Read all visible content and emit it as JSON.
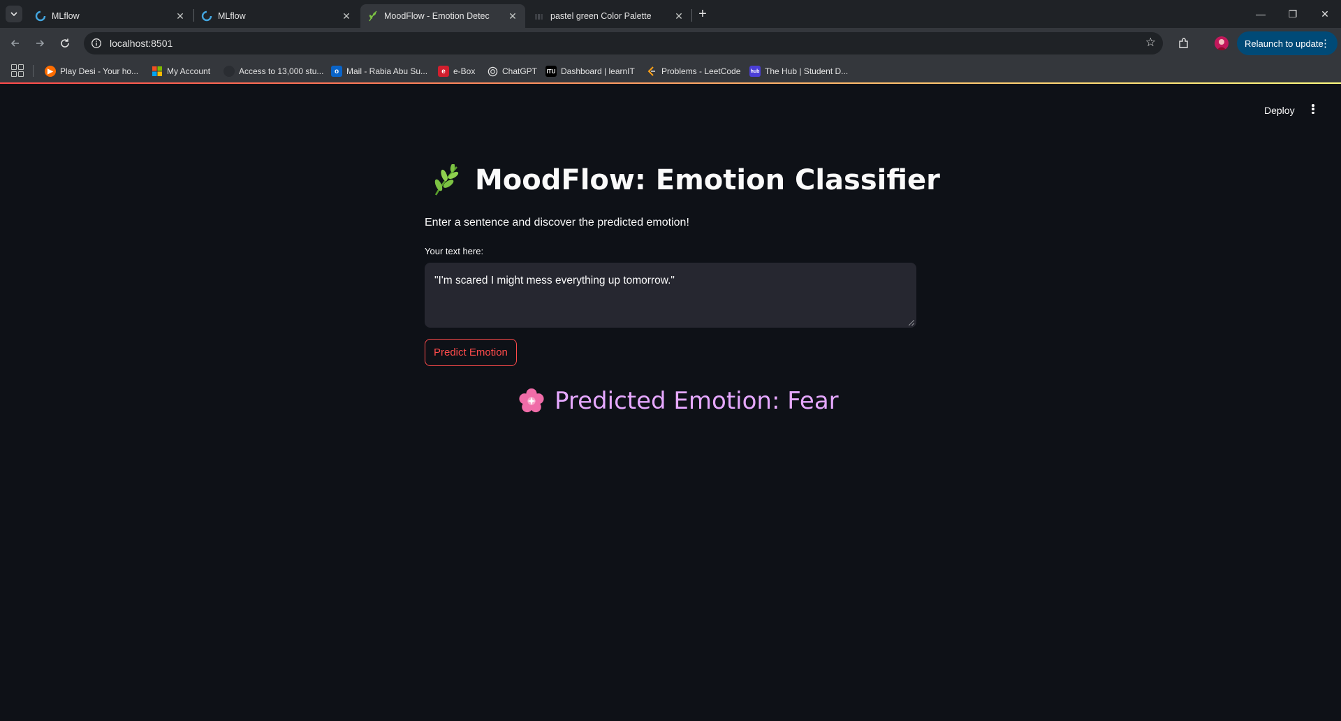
{
  "browser": {
    "tabs": [
      {
        "title": "MLflow",
        "active": false
      },
      {
        "title": "MLflow",
        "active": false
      },
      {
        "title": "MoodFlow - Emotion Detec",
        "active": true
      },
      {
        "title": "pastel green Color Palette",
        "active": false
      }
    ],
    "url": "localhost:8501",
    "relaunch_label": "Relaunch to update",
    "bookmarks": [
      {
        "label": "Play Desi - Your ho...",
        "icon": "play-icon"
      },
      {
        "label": "My Account",
        "icon": "microsoft-icon"
      },
      {
        "label": "Access to 13,000 stu...",
        "icon": "globe-icon"
      },
      {
        "label": "Mail - Rabia Abu Su...",
        "icon": "outlook-icon"
      },
      {
        "label": "e-Box",
        "icon": "ebox-icon"
      },
      {
        "label": "ChatGPT",
        "icon": "chatgpt-icon"
      },
      {
        "label": "Dashboard | learnIT",
        "icon": "itu-icon"
      },
      {
        "label": "Problems - LeetCode",
        "icon": "leetcode-icon"
      },
      {
        "label": "The Hub | Student D...",
        "icon": "hub-icon"
      }
    ]
  },
  "app": {
    "deploy_label": "Deploy",
    "title": "MoodFlow: Emotion Classifier",
    "subtitle": "Enter a sentence and discover the predicted emotion!",
    "input_label": "Your text here:",
    "input_value": "\"I'm scared I might mess everything up tomorrow.\"",
    "predict_label": "Predict Emotion",
    "result_text": "Predicted Emotion: Fear",
    "colors": {
      "background": "#0e1117",
      "accent": "#ff4b4b",
      "result": "#e6a8ff",
      "input_bg": "#262730"
    }
  }
}
